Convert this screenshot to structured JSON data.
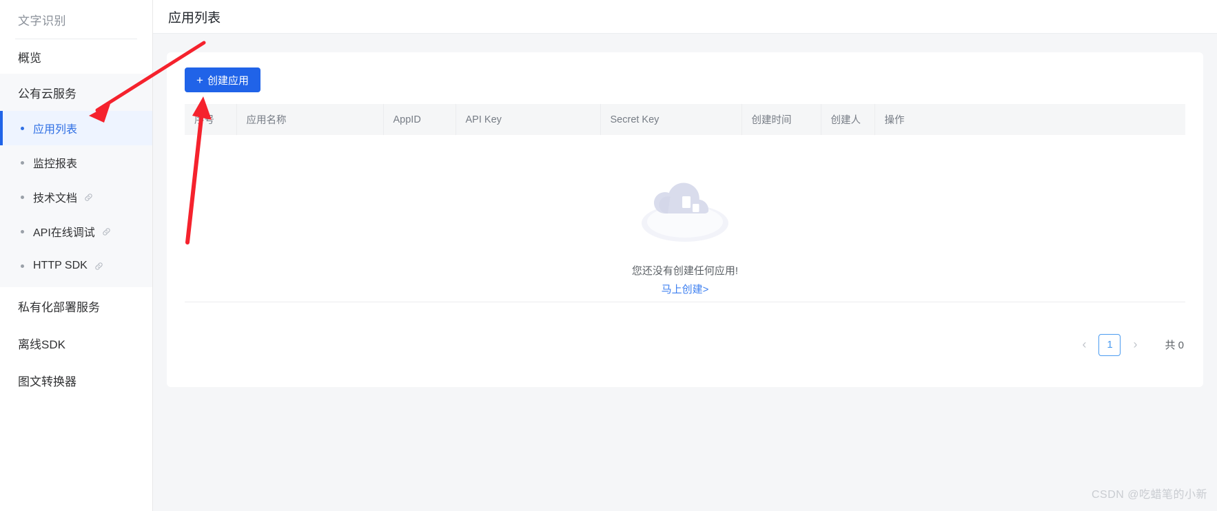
{
  "sidebar": {
    "title": "文字识别",
    "overview": {
      "label": "概览",
      "icon": "none"
    },
    "group": {
      "label": "公有云服务",
      "items": [
        {
          "label": "应用列表",
          "active": true,
          "external": false
        },
        {
          "label": "监控报表",
          "active": false,
          "external": false
        },
        {
          "label": "技术文档",
          "active": false,
          "external": true,
          "icon": "link-icon"
        },
        {
          "label": "API在线调试",
          "active": false,
          "external": true,
          "icon": "link-icon"
        },
        {
          "label": "HTTP SDK",
          "active": false,
          "external": true,
          "icon": "link-icon"
        }
      ]
    },
    "bottom_items": [
      {
        "label": "私有化部署服务"
      },
      {
        "label": "离线SDK"
      },
      {
        "label": "图文转换器"
      }
    ]
  },
  "header": {
    "title": "应用列表"
  },
  "toolbar": {
    "create_plus": "+",
    "create_label": "创建应用"
  },
  "table": {
    "columns": [
      {
        "label": "序号"
      },
      {
        "label": "应用名称"
      },
      {
        "label": "AppID"
      },
      {
        "label": "API Key"
      },
      {
        "label": "Secret Key"
      },
      {
        "label": "创建时间"
      },
      {
        "label": "创建人"
      },
      {
        "label": "操作"
      }
    ],
    "rows": []
  },
  "empty_state": {
    "illustration": "cloud-illustration",
    "message": "您还没有创建任何应用!",
    "link_label": "马上创建>"
  },
  "pagination": {
    "prev": "‹",
    "next": "›",
    "current_page": "1",
    "total_label": "共 0"
  },
  "watermark": {
    "text": "CSDN @吃蜡笔的小新"
  },
  "colors": {
    "primary": "#2063e8",
    "active_nav_bg": "#eef4ff",
    "active_nav_text": "#2f6fe4",
    "annotation_red": "#f5222d",
    "link_blue": "#3d7ff0"
  }
}
